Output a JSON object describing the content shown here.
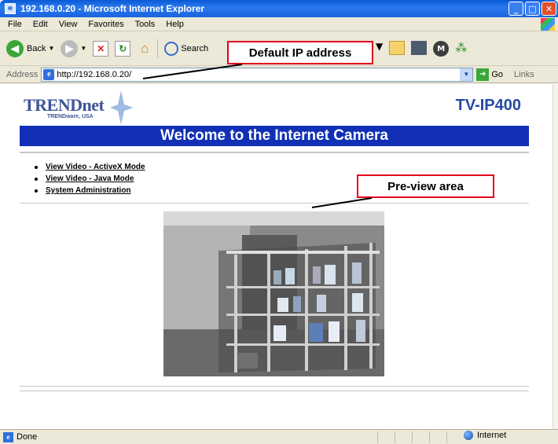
{
  "window": {
    "title": "192.168.0.20 - Microsoft Internet Explorer",
    "minimize": "_",
    "maximize": "□",
    "close": "✕"
  },
  "menu": [
    "File",
    "Edit",
    "View",
    "Favorites",
    "Tools",
    "Help"
  ],
  "toolbar": {
    "back_label": "Back",
    "search_label": "Search"
  },
  "address": {
    "label": "Address",
    "url": "http://192.168.0.20/",
    "go_label": "Go",
    "links_label": "Links"
  },
  "page": {
    "brand": "TRENDnet",
    "brand_sub": "TRENDware, USA",
    "model": "TV-IP400",
    "banner": "Welcome to the Internet Camera",
    "nav": [
      "View Video - ActiveX Mode",
      "View Video - Java Mode",
      "System Administration"
    ]
  },
  "callouts": {
    "ip": "Default IP address",
    "preview": "Pre-view area"
  },
  "status": {
    "text": "Done",
    "zone": "Internet"
  },
  "colors": {
    "banner_bg": "#1130b5",
    "callout_border": "#e3001b",
    "title_bar": "#1a64e0"
  }
}
